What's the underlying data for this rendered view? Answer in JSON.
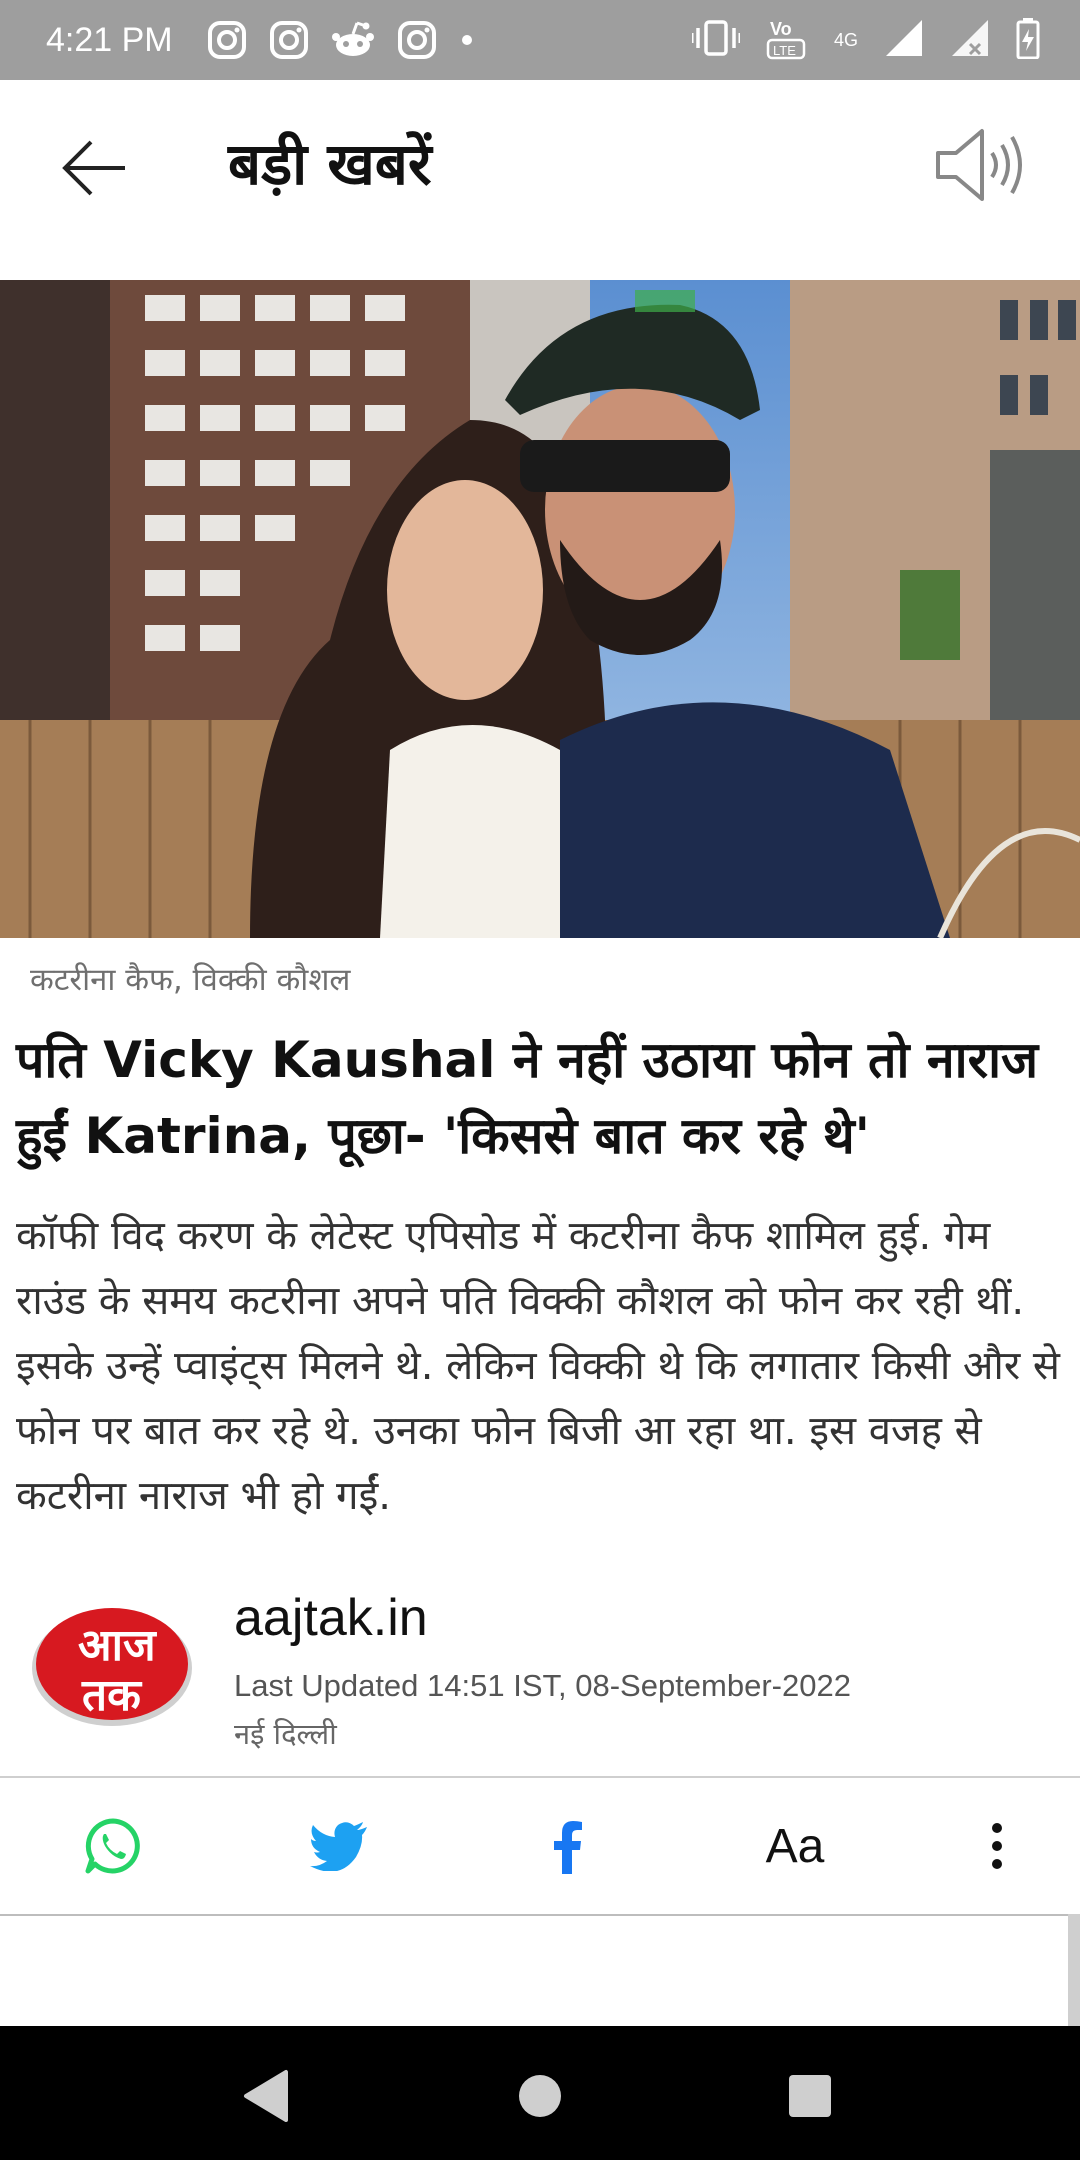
{
  "status_bar": {
    "time": "4:21 PM",
    "apps": [
      "instagram-icon",
      "instagram-icon",
      "reddit-icon",
      "instagram-icon"
    ],
    "network": "4G",
    "volte": "VoLTE"
  },
  "header": {
    "title": "बड़ी खबरें",
    "back_icon": "back-arrow-icon",
    "audio_icon": "speaker-icon"
  },
  "article": {
    "tags": "कटरीना कैफ, विक्की कौशल",
    "headline": "पति Vicky Kaushal ने नहीं उठाया फोन तो नाराज हुईं Katrina, पूछा- 'किससे बात कर रहे थे'",
    "summary": "कॉफी विद करण के लेटेस्ट एपिसोड में कटरीना कैफ शामिल हुई. गेम राउंड के समय कटरीना अपने पति विक्की कौशल को फोन कर रही थीं. इसके उन्हें प्वाइंट्स मिलने थे. लेकिन विक्की थे कि लगातार किसी और से फोन पर बात कर रहे थे. उनका फोन बिजी आ रहा था. इस वजह से कटरीना नाराज भी हो गईं."
  },
  "source": {
    "logo_text_top": "आज",
    "logo_text_bottom": "तक",
    "name": "aajtak.in",
    "updated": "Last Updated 14:51 IST, 08-September-2022",
    "city": "नई दिल्ली"
  },
  "share_bar": {
    "font_size_label": "Aa",
    "icons": [
      "whatsapp-icon",
      "twitter-icon",
      "facebook-icon",
      "font-size-icon",
      "more-vertical-icon"
    ],
    "colors": {
      "whatsapp": "#25D366",
      "twitter": "#1DA1F2",
      "facebook": "#1877F2"
    }
  },
  "nav_bar": {
    "icons": [
      "nav-back-icon",
      "nav-home-icon",
      "nav-recents-icon"
    ]
  },
  "colors": {
    "status_bar": "#9e9e9e",
    "brand_red": "#d71920"
  }
}
